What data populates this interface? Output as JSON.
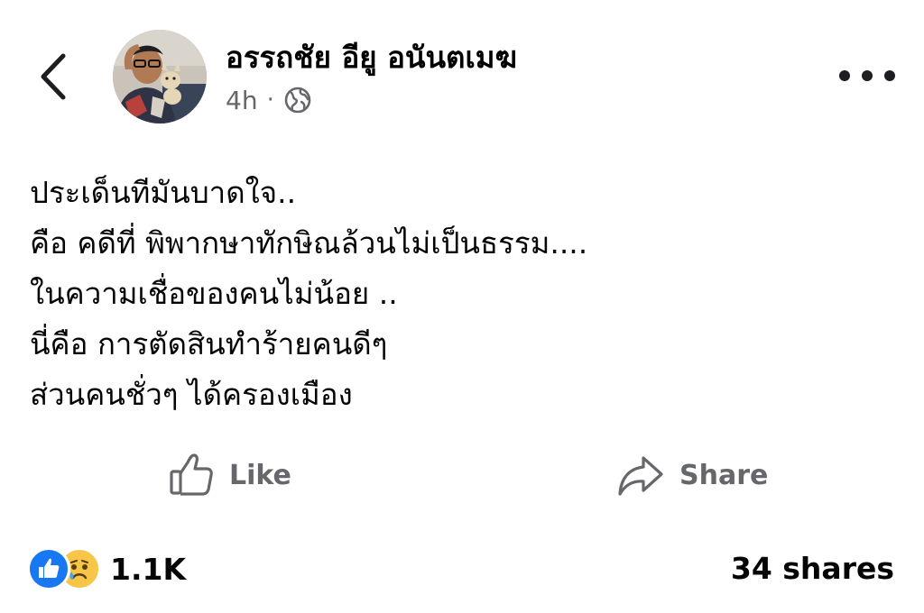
{
  "post": {
    "author": "อรรถชัย อียู อนันตเมฆ",
    "time": "4h",
    "separator": "·",
    "privacy_icon": "globe-icon",
    "lines": [
      "ประเด็นทีมันบาดใจ..",
      "คือ คดีที่ พิพากษาทักษิณล้วนไม่เป็นธรรม....",
      "ในความเชื่อของคนไม่น้อย ..",
      "นี่คือ การตัดสินทำร้ายคนดีๆ",
      "ส่วนคนชั่วๆ ได้ครองเมือง"
    ]
  },
  "actions": {
    "like_label": "Like",
    "share_label": "Share"
  },
  "stats": {
    "reaction_count": "1.1K",
    "shares": "34 shares",
    "reaction_icons": [
      "like-icon",
      "sad-icon"
    ]
  },
  "colors": {
    "secondary_text": "#65676b",
    "like_blue": "#1877f2"
  }
}
